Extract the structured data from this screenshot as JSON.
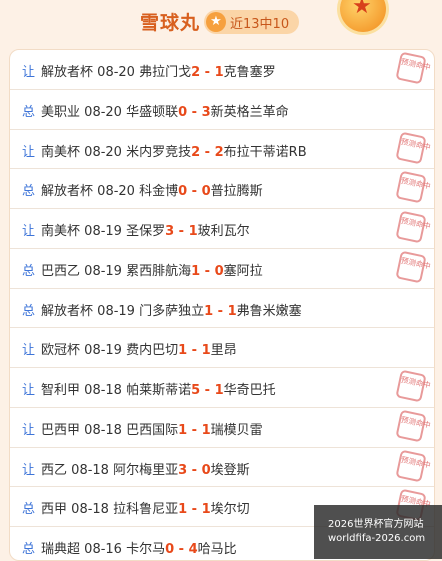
{
  "header": {
    "title": "雪球丸",
    "record_icon": "star-icon",
    "record_text": "近13中10",
    "medal_icon": "star-medal-icon"
  },
  "colors": {
    "accent": "#d8601f",
    "score": "#e8491a",
    "type_label": "#3d74d8",
    "stamp": "#e27777"
  },
  "predictions": [
    {
      "type": "让",
      "league": "解放者杯",
      "date": "08-20",
      "home": "弗拉门戈",
      "hs": "2",
      "sep": " - ",
      "as": "1",
      "away": "克鲁塞罗",
      "hit": true
    },
    {
      "type": "总",
      "league": "美职业",
      "date": "08-20",
      "home": "华盛顿联",
      "hs": "0",
      "sep": " - ",
      "as": "3",
      "away": "新英格兰革命",
      "hit": false
    },
    {
      "type": "让",
      "league": "南美杯",
      "date": "08-20",
      "home": "米内罗竞技",
      "hs": "2",
      "sep": " - ",
      "as": "2",
      "away": "布拉干蒂诺RB",
      "hit": true
    },
    {
      "type": "总",
      "league": "解放者杯",
      "date": "08-20",
      "home": "科金博",
      "hs": "0",
      "sep": " - ",
      "as": "0",
      "away": "普拉腾斯",
      "hit": true
    },
    {
      "type": "让",
      "league": "南美杯",
      "date": "08-19",
      "home": "圣保罗",
      "hs": "3",
      "sep": " - ",
      "as": "1",
      "away": "玻利瓦尔",
      "hit": true
    },
    {
      "type": "总",
      "league": "巴西乙",
      "date": "08-19",
      "home": "累西腓航海",
      "hs": "1",
      "sep": " - ",
      "as": "0",
      "away": "塞阿拉",
      "hit": true
    },
    {
      "type": "总",
      "league": "解放者杯",
      "date": "08-19",
      "home": "门多萨独立",
      "hs": "1",
      "sep": " - ",
      "as": "1",
      "away": "弗鲁米嫩塞",
      "hit": false
    },
    {
      "type": "让",
      "league": "欧冠杯",
      "date": "08-19",
      "home": "费内巴切",
      "hs": "1",
      "sep": " - ",
      "as": "1",
      "away": "里昂",
      "hit": false
    },
    {
      "type": "让",
      "league": "智利甲",
      "date": "08-18",
      "home": "帕莱斯蒂诺",
      "hs": "5",
      "sep": " - ",
      "as": "1",
      "away": "华奇巴托",
      "hit": true
    },
    {
      "type": "让",
      "league": "巴西甲",
      "date": "08-18",
      "home": "巴西国际",
      "hs": "1",
      "sep": " - ",
      "as": "1",
      "away": "瑞模贝雷",
      "hit": true
    },
    {
      "type": "让",
      "league": "西乙",
      "date": "08-18",
      "home": "阿尔梅里亚",
      "hs": "3",
      "sep": " - ",
      "as": "0",
      "away": "埃登斯",
      "hit": true
    },
    {
      "type": "总",
      "league": "西甲",
      "date": "08-18",
      "home": "拉科鲁尼亚",
      "hs": "1",
      "sep": " - ",
      "as": "1",
      "away": "埃尔切",
      "hit": true
    },
    {
      "type": "总",
      "league": "瑞典超",
      "date": "08-16",
      "home": "卡尔马",
      "hs": "0",
      "sep": " - ",
      "as": "4",
      "away": "哈马比",
      "hit": false
    }
  ],
  "stamp_text": "预测命中",
  "watermark": {
    "line1": "2026世界杯官方网站",
    "line2": "worldfifa-2026.com"
  }
}
